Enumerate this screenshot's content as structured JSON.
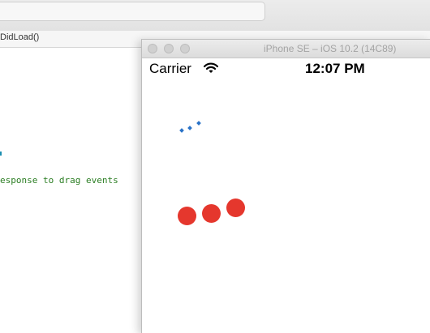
{
  "editor": {
    "jump_bar_label": "DidLoad()",
    "comment_line": "esponse to drag events"
  },
  "simulator": {
    "window_title": "iPhone SE – iOS 10.2 (14C89)",
    "status_bar": {
      "carrier": "Carrier",
      "time": "12:07 PM",
      "wifi_icon": "wifi-icon"
    },
    "colors": {
      "dots_small": "#2a73c8",
      "dots_large": "#e5372d"
    }
  }
}
